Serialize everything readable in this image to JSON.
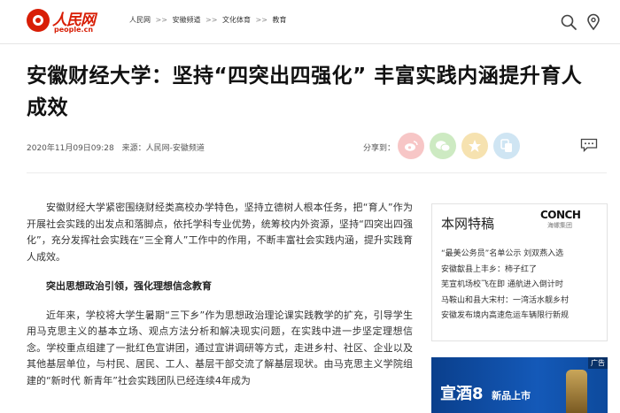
{
  "header": {
    "logo_cn": "人民网",
    "logo_en": "people.cn",
    "breadcrumbs": [
      "人民网",
      "安徽频道",
      "文化体育",
      "教育"
    ],
    "breadcrumb_sep": ">>"
  },
  "article": {
    "title": "安徽财经大学：坚持“四突出四强化” 丰富实践内涵提升育人成效",
    "datetime": "2020年11月09日09:28",
    "source": "来源：人民网-安徽频道",
    "share_label": "分享到：",
    "paragraphs": [
      "安徽财经大学紧密围绕财经类高校办学特色，坚持立德树人根本任务，把“育人”作为开展社会实践的出发点和落脚点，依托学科专业优势，统筹校内外资源，坚持“四突出四强化”，充分发挥社会实践在“三全育人”工作中的作用，不断丰富社会实践内涵，提升实践育人成效。",
      "突出思想政治引领，强化理想信念教育",
      "近年来，学校将大学生暑期“三下乡”作为思想政治理论课实践教学的扩充，引导学生用马克思主义的基本立场、观点方法分析和解决现实问题，在实践中进一步坚定理想信念。学校重点组建了一批红色宣讲团，通过宣讲调研等方式，走进乡村、社区、企业以及其他基层单位，与村民、居民、工人、基层干部交流了解基层现状。由马克思主义学院组建的“新时代 新青年”社会实践团队已经连续4年成为"
    ]
  },
  "sidebar": {
    "title": "本网特稿",
    "logo_big": "CONCH",
    "logo_small": "海螺集团",
    "items": [
      "“最美公务员”名单公示 刘双燕入选",
      "安徽歙县上丰乡：柿子红了",
      "芜宣机场校飞在即 通航进入倒计时",
      "马鞍山和县大宋村：一湾活水靓乡村",
      "安徽发布境内高速危运车辆限行新规"
    ]
  },
  "ad": {
    "tag": "广告",
    "brand": "宣酒8",
    "sub": "新品上市"
  },
  "icons": {
    "search": "search-icon",
    "location": "location-icon",
    "weibo": "weibo-icon",
    "wechat": "wechat-icon",
    "star": "star-icon",
    "copy": "copy-icon",
    "comment": "comment-icon"
  },
  "colors": {
    "brand_red": "#d81e06",
    "weibo_bg": "#f7c6c6",
    "wechat_bg": "#cdeac2",
    "star_bg": "#f6e2b0",
    "copy_bg": "#cfe5f3",
    "ad_blue": "#1459b8"
  }
}
